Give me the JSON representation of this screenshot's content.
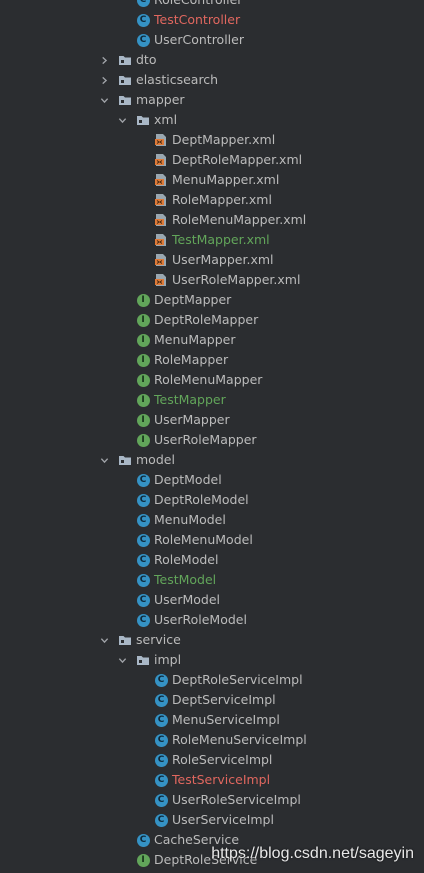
{
  "tree": {
    "rows": [
      {
        "label": "RoleController",
        "type": "class",
        "depth": 3,
        "status": "default"
      },
      {
        "label": "TestController",
        "type": "class",
        "depth": 3,
        "status": "modified"
      },
      {
        "label": "UserController",
        "type": "class",
        "depth": 3,
        "status": "default"
      },
      {
        "label": "dto",
        "type": "package",
        "depth": 2,
        "expanded": false,
        "status": "default"
      },
      {
        "label": "elasticsearch",
        "type": "package",
        "depth": 2,
        "expanded": false,
        "status": "default"
      },
      {
        "label": "mapper",
        "type": "package",
        "depth": 2,
        "expanded": true,
        "status": "default"
      },
      {
        "label": "xml",
        "type": "package",
        "depth": 3,
        "expanded": true,
        "status": "default"
      },
      {
        "label": "DeptMapper.xml",
        "type": "xml",
        "depth": 4,
        "status": "default"
      },
      {
        "label": "DeptRoleMapper.xml",
        "type": "xml",
        "depth": 4,
        "status": "default"
      },
      {
        "label": "MenuMapper.xml",
        "type": "xml",
        "depth": 4,
        "status": "default"
      },
      {
        "label": "RoleMapper.xml",
        "type": "xml",
        "depth": 4,
        "status": "default"
      },
      {
        "label": "RoleMenuMapper.xml",
        "type": "xml",
        "depth": 4,
        "status": "default"
      },
      {
        "label": "TestMapper.xml",
        "type": "xml",
        "depth": 4,
        "status": "added"
      },
      {
        "label": "UserMapper.xml",
        "type": "xml",
        "depth": 4,
        "status": "default"
      },
      {
        "label": "UserRoleMapper.xml",
        "type": "xml",
        "depth": 4,
        "status": "default"
      },
      {
        "label": "DeptMapper",
        "type": "interface",
        "depth": 3,
        "status": "default"
      },
      {
        "label": "DeptRoleMapper",
        "type": "interface",
        "depth": 3,
        "status": "default"
      },
      {
        "label": "MenuMapper",
        "type": "interface",
        "depth": 3,
        "status": "default"
      },
      {
        "label": "RoleMapper",
        "type": "interface",
        "depth": 3,
        "status": "default"
      },
      {
        "label": "RoleMenuMapper",
        "type": "interface",
        "depth": 3,
        "status": "default"
      },
      {
        "label": "TestMapper",
        "type": "interface",
        "depth": 3,
        "status": "added"
      },
      {
        "label": "UserMapper",
        "type": "interface",
        "depth": 3,
        "status": "default"
      },
      {
        "label": "UserRoleMapper",
        "type": "interface",
        "depth": 3,
        "status": "default"
      },
      {
        "label": "model",
        "type": "package",
        "depth": 2,
        "expanded": true,
        "status": "default"
      },
      {
        "label": "DeptModel",
        "type": "class",
        "depth": 3,
        "status": "default"
      },
      {
        "label": "DeptRoleModel",
        "type": "class",
        "depth": 3,
        "status": "default"
      },
      {
        "label": "MenuModel",
        "type": "class",
        "depth": 3,
        "status": "default"
      },
      {
        "label": "RoleMenuModel",
        "type": "class",
        "depth": 3,
        "status": "default"
      },
      {
        "label": "RoleModel",
        "type": "class",
        "depth": 3,
        "status": "default"
      },
      {
        "label": "TestModel",
        "type": "class",
        "depth": 3,
        "status": "added"
      },
      {
        "label": "UserModel",
        "type": "class",
        "depth": 3,
        "status": "default"
      },
      {
        "label": "UserRoleModel",
        "type": "class",
        "depth": 3,
        "status": "default"
      },
      {
        "label": "service",
        "type": "package",
        "depth": 2,
        "expanded": true,
        "status": "default"
      },
      {
        "label": "impl",
        "type": "package",
        "depth": 3,
        "expanded": true,
        "status": "default"
      },
      {
        "label": "DeptRoleServiceImpl",
        "type": "class",
        "depth": 4,
        "status": "default"
      },
      {
        "label": "DeptServiceImpl",
        "type": "class",
        "depth": 4,
        "status": "default"
      },
      {
        "label": "MenuServiceImpl",
        "type": "class",
        "depth": 4,
        "status": "default"
      },
      {
        "label": "RoleMenuServiceImpl",
        "type": "class",
        "depth": 4,
        "status": "default"
      },
      {
        "label": "RoleServiceImpl",
        "type": "class",
        "depth": 4,
        "status": "default"
      },
      {
        "label": "TestServiceImpl",
        "type": "class",
        "depth": 4,
        "status": "modified"
      },
      {
        "label": "UserRoleServiceImpl",
        "type": "class",
        "depth": 4,
        "status": "default"
      },
      {
        "label": "UserServiceImpl",
        "type": "class",
        "depth": 4,
        "status": "default"
      },
      {
        "label": "CacheService",
        "type": "class",
        "depth": 3,
        "status": "default"
      },
      {
        "label": "DeptRoleService",
        "type": "interface",
        "depth": 3,
        "status": "default"
      }
    ]
  },
  "badges": {
    "class": "C",
    "interface": "I"
  },
  "colors": {
    "background": "#2b2d30",
    "text_default": "#bbbbbb",
    "text_modified": "#e0675f",
    "text_added": "#62a55a",
    "class_badge": "#3592c4",
    "interface_badge": "#62a55a",
    "folder": "#a9b7c6"
  },
  "watermark": "https://blog.csdn.net/sageyin"
}
